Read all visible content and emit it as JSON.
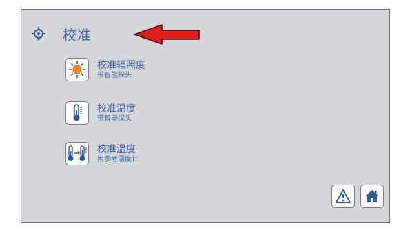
{
  "header": {
    "title": "校准",
    "icon": "target-icon"
  },
  "annotation": {
    "icon": "red-arrow",
    "color": "#e01e1e"
  },
  "menu": {
    "items": [
      {
        "title": "校准辐照度",
        "subtitle": "带智能探头",
        "icon": "sun-icon"
      },
      {
        "title": "校准温度",
        "subtitle": "带智能探头",
        "icon": "thermometer-icon"
      },
      {
        "title": "校准温度",
        "subtitle": "用参考温度计",
        "icon": "thermometer-compare-icon"
      }
    ]
  },
  "footer": {
    "warning_icon": "warning-icon",
    "home_icon": "home-icon"
  },
  "colors": {
    "background": "#d4d6d9",
    "accent_text": "#3f66a8",
    "icon_blue": "#2d5b9e",
    "sun_orange": "#f0891a"
  }
}
